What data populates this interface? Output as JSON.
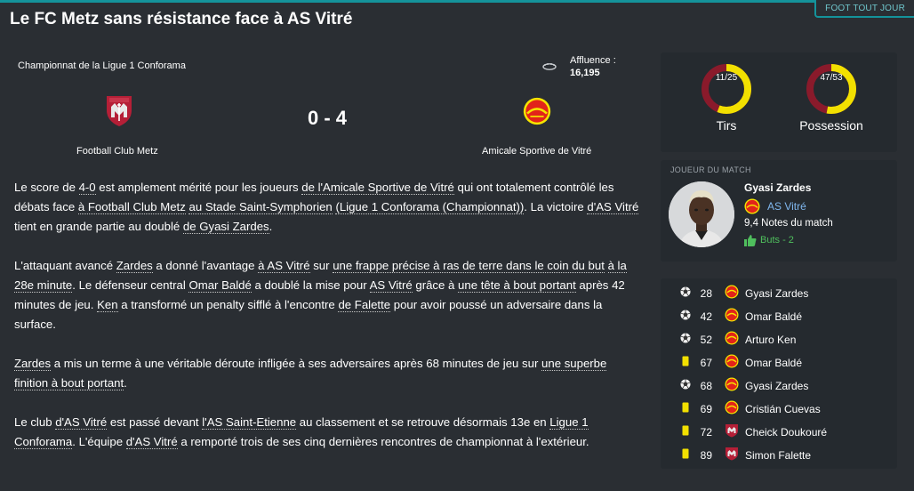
{
  "header": {
    "corner_label": "FOOT TOUT JOUR",
    "headline": "Le FC Metz sans résistance face à AS Vitré"
  },
  "match": {
    "competition": "Championnat de la Ligue 1 Conforama",
    "attendance_label": "Affluence :",
    "attendance_value": "16,195",
    "score": "0 - 4",
    "home_team": "Football Club Metz",
    "away_team": "Amicale Sportive de Vitré",
    "home_crest": "fc-metz-crest",
    "away_crest": "as-vitre-crest"
  },
  "article": {
    "p1": {
      "t1": "Le score de ",
      "l1": "4-0",
      "t2": " est amplement mérité pour les joueurs ",
      "l2": "de l'Amicale Sportive de Vitré",
      "t3": " qui ont totalement contrôlé les débats face ",
      "l3": "à Football Club Metz",
      "t4": " ",
      "l4": "au Stade Saint-Symphorien",
      "t5": " ",
      "l5": "(Ligue 1 Conforama (Championnat))",
      "t6": ". La victoire ",
      "l6": "d'AS Vitré",
      "t7": " tient en grande partie au doublé ",
      "l7": "de Gyasi Zardes",
      "t8": "."
    },
    "p2": {
      "t1": "L'attaquant avancé ",
      "l1": "Zardes",
      "t2": " a donné l'avantage ",
      "l2": "à AS Vitré",
      "t3": " sur ",
      "l3": "une frappe précise à ras de terre dans le coin du but",
      "t4": " ",
      "l4": "à la 28e minute",
      "t5": ". Le défenseur central ",
      "l5": "Omar Baldé",
      "t6": " a doublé la mise pour ",
      "l6": "AS Vitré",
      "t7": " grâce à ",
      "l7": "une tête à bout portant",
      "t8": " après 42 minutes de jeu. ",
      "l8": "Ken",
      "t9": " a transformé un penalty sifflé à l'encontre ",
      "l9": "de Falette",
      "t10": " pour avoir poussé un adversaire dans la surface."
    },
    "p3": {
      "l1": "Zardes",
      "t1": " a mis un terme à une véritable déroute infligée à ses adversaires après 68 minutes de jeu sur ",
      "l2": "une superbe finition à bout portant",
      "t2": "."
    },
    "p4": {
      "t1": "Le club ",
      "l1": "d'AS Vitré",
      "t2": " est passé devant ",
      "l2": "l'AS Saint-Etienne",
      "t3": " au classement et se retrouve désormais 13e en ",
      "l3": "Ligue 1 Conforama",
      "t4": ". L'équipe ",
      "l4": "d'AS Vitré",
      "t5": " a remporté trois de ses cinq dernières rencontres de championnat à l'extérieur."
    }
  },
  "stats": {
    "shots": {
      "label": "Tirs",
      "value": "11/25",
      "home": 11,
      "away": 14
    },
    "possession": {
      "label": "Possession",
      "value": "47/53",
      "home": 47,
      "away": 53
    },
    "home_color": "#8a1a2b",
    "away_color": "#f2e000"
  },
  "man_of_match": {
    "title": "JOUEUR DU MATCH",
    "name": "Gyasi Zardes",
    "club": "AS Vitré",
    "rating": "9,4 Notes du match",
    "goals": "Buts - 2"
  },
  "events": [
    {
      "type": "goal",
      "icon": "ball-icon",
      "minute": "28",
      "team": "vitre",
      "player": "Gyasi Zardes"
    },
    {
      "type": "goal",
      "icon": "ball-icon",
      "minute": "42",
      "team": "vitre",
      "player": "Omar Baldé"
    },
    {
      "type": "goal",
      "icon": "ball-icon",
      "minute": "52",
      "team": "vitre",
      "player": "Arturo Ken"
    },
    {
      "type": "yellow",
      "icon": "yellow-card-icon",
      "minute": "67",
      "team": "vitre",
      "player": "Omar Baldé"
    },
    {
      "type": "goal",
      "icon": "ball-icon",
      "minute": "68",
      "team": "vitre",
      "player": "Gyasi Zardes"
    },
    {
      "type": "yellow",
      "icon": "yellow-card-icon",
      "minute": "69",
      "team": "vitre",
      "player": "Cristián Cuevas"
    },
    {
      "type": "yellow",
      "icon": "yellow-card-icon",
      "minute": "72",
      "team": "metz",
      "player": "Cheick Doukouré"
    },
    {
      "type": "yellow",
      "icon": "yellow-card-icon",
      "minute": "89",
      "team": "metz",
      "player": "Simon Falette"
    }
  ]
}
